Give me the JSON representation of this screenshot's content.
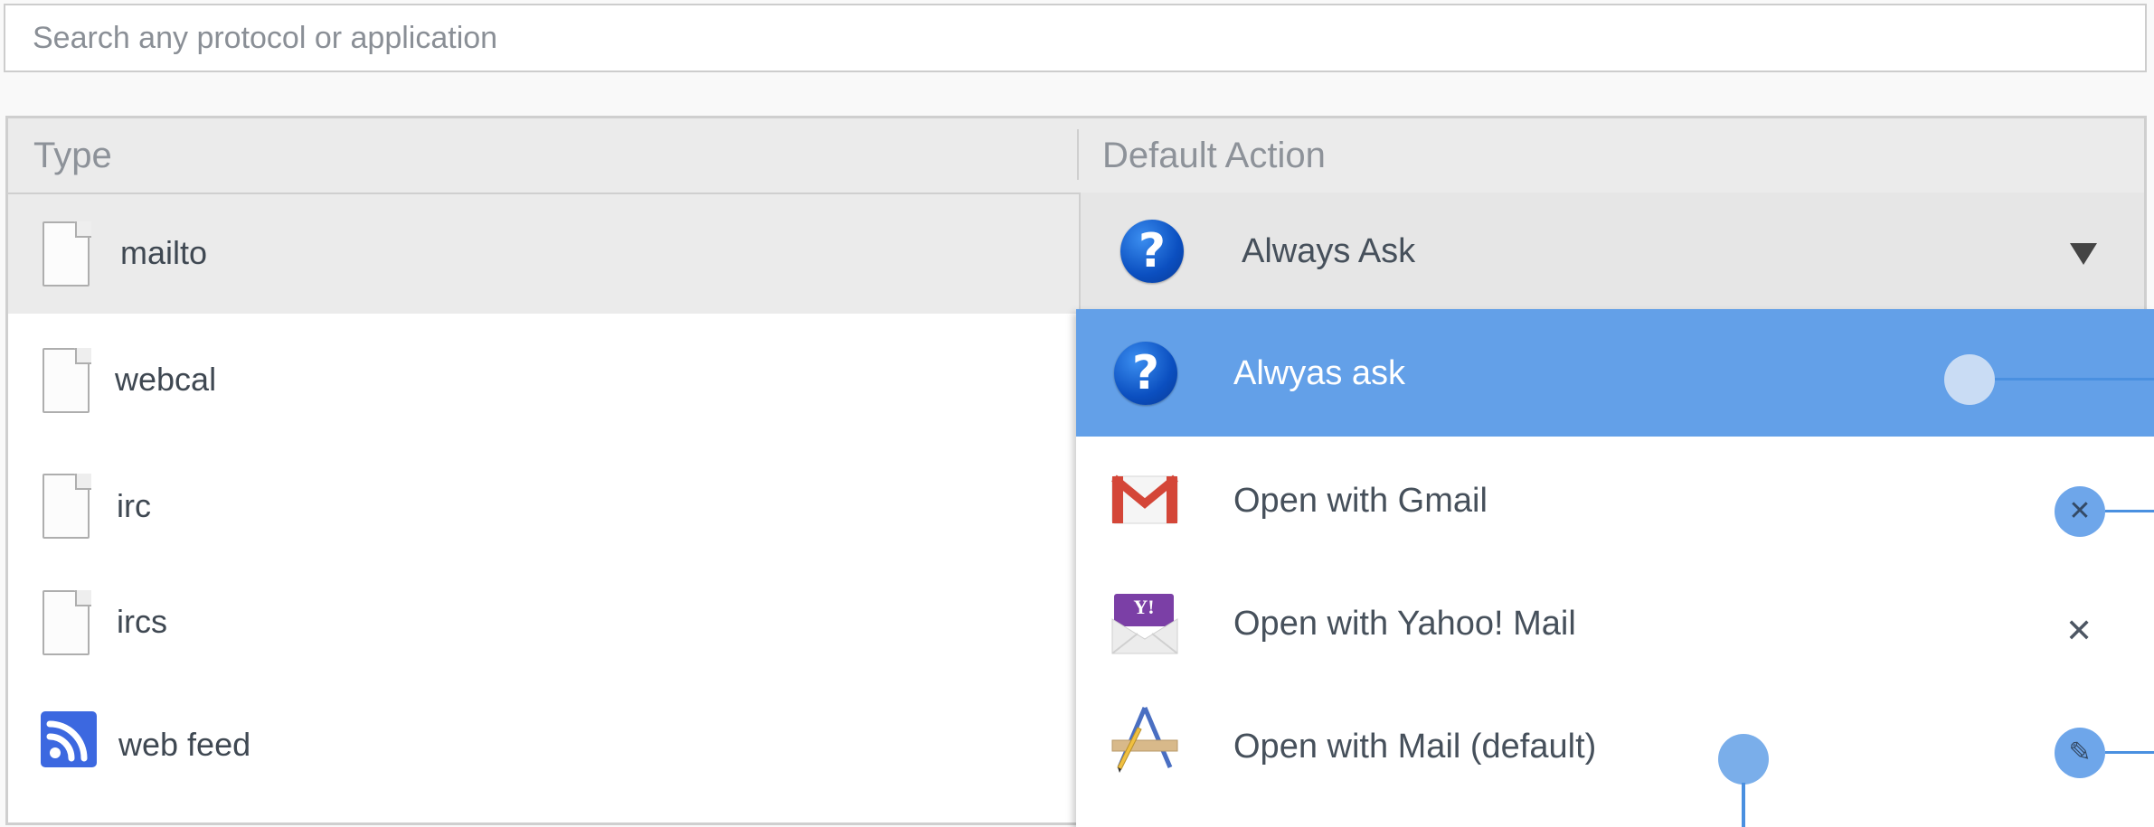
{
  "search": {
    "placeholder": "Search any protocol or application"
  },
  "table": {
    "headers": {
      "type": "Type",
      "action": "Default Action"
    },
    "rows": [
      {
        "label": "mailto",
        "icon": "document-icon"
      },
      {
        "label": "webcal",
        "icon": "document-icon"
      },
      {
        "label": "irc",
        "icon": "document-icon"
      },
      {
        "label": "ircs",
        "icon": "document-icon"
      },
      {
        "label": "web feed",
        "icon": "rss-feed-icon"
      }
    ]
  },
  "selected_action": {
    "label": "Always Ask",
    "icon": "question-icon"
  },
  "menu": {
    "items": [
      {
        "label": "Alwyas ask",
        "icon": "question-icon"
      },
      {
        "label": "Open with Gmail",
        "icon": "gmail-icon",
        "control": "remove"
      },
      {
        "label": "Open with Yahoo! Mail",
        "icon": "yahoo-mail-icon",
        "control": "remove"
      },
      {
        "label": "Open with Mail (default)",
        "icon": "mail-app-icon",
        "control": "edit"
      }
    ],
    "yahoo_badge": "Y!"
  },
  "colors": {
    "highlight": "#63a0e8",
    "annotation": "#4a90e0",
    "rss": "#3c68e0",
    "gmail_red": "#d44638",
    "yahoo_purple": "#7b3fa6"
  }
}
